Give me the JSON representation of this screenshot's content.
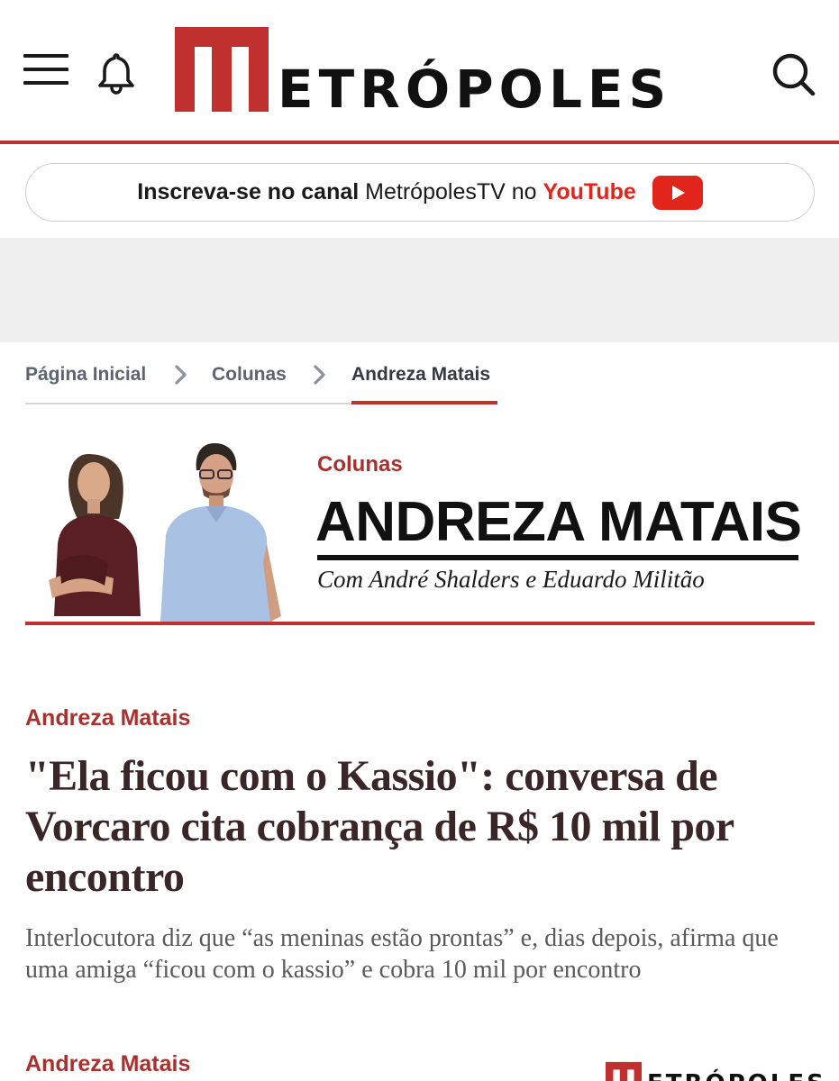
{
  "header": {
    "logo_text": "ETRÓPOLES",
    "logo_full": "Metrópoles"
  },
  "promo": {
    "bold_text": "Inscreva-se no canal",
    "channel": "MetrópolesTV",
    "connector": "no",
    "platform": "YouTube"
  },
  "breadcrumb": {
    "items": [
      {
        "label": "Página Inicial"
      },
      {
        "label": "Colunas"
      },
      {
        "label": "Andreza Matais"
      }
    ]
  },
  "column": {
    "section_label": "Colunas",
    "title": "ANDREZA MATAIS",
    "subtitle": "Com André Shalders e Eduardo Militão"
  },
  "article": {
    "category": "Andreza Matais",
    "title": "\"Ela ficou com o Kassio\": conversa de Vorcaro cita cobrança de R$ 10 mil por encontro",
    "subtitle": "Interlocutora diz que “as meninas estão prontas” e, dias depois, afirma que uma amiga “ficou com o kassio” e cobra 10 mil por encontro",
    "author": "Andreza Matais"
  },
  "colors": {
    "brand_red": "#c0302e",
    "youtube_red": "#e1251b",
    "title_color": "#3a2627",
    "category_red": "#a8312e"
  },
  "icons": {
    "menu": "hamburger-menu-icon",
    "notifications": "bell-icon",
    "search": "search-icon",
    "youtube": "youtube-play-icon",
    "breadcrumb_separator": "chevron-right-icon"
  }
}
